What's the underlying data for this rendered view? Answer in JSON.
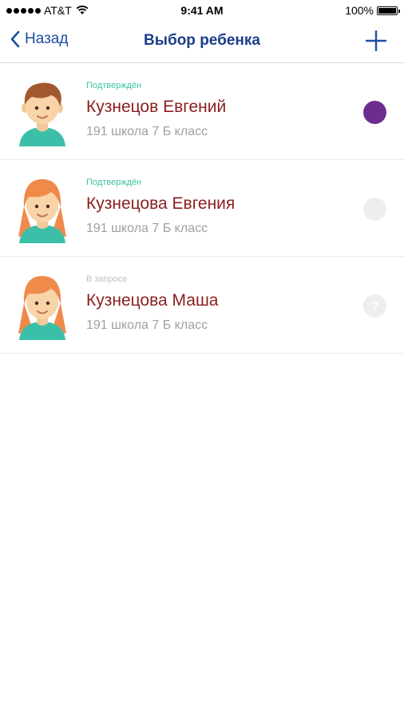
{
  "status_bar": {
    "carrier": "AT&T",
    "time": "9:41 AM",
    "battery": "100%"
  },
  "nav": {
    "back_label": "Назад",
    "title": "Выбор ребенка"
  },
  "colors": {
    "accent": "#1d4fa0",
    "name": "#8b1e1e",
    "confirmed": "#3cc3a3",
    "pending": "#c0c0c0",
    "selected_indicator": "#6c2d91",
    "inactive_indicator": "#eeeeee"
  },
  "children": [
    {
      "status": "Подтверждён",
      "name": "Кузнецов Евгений",
      "school": "191 школа 7 Б класс",
      "avatar": "boy-avatar",
      "indicator": "selected"
    },
    {
      "status": "Подтверждён",
      "name": "Кузнецова Евгения",
      "school": "191 школа 7 Б класс",
      "avatar": "girl-avatar",
      "indicator": "unselected"
    },
    {
      "status": "В запросе",
      "name": "Кузнецова Маша",
      "school": "191 школа 7 Б класс",
      "avatar": "girl-avatar",
      "indicator": "question",
      "indicator_text": "?"
    }
  ]
}
